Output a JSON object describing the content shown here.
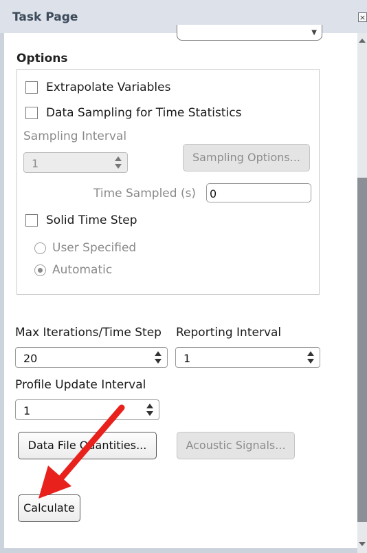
{
  "title": "Task Page",
  "close_icon_glyph": "×",
  "options": {
    "heading": "Options",
    "extrapolate_label": "Extrapolate Variables",
    "data_sampling_label": "Data Sampling for Time Statistics",
    "sampling_interval_label": "Sampling Interval",
    "sampling_interval_value": "1",
    "sampling_options_button": "Sampling Options...",
    "time_sampled_label": "Time Sampled (s)",
    "time_sampled_value": "0",
    "solid_time_step_label": "Solid Time Step",
    "user_specified_label": "User Specified",
    "automatic_label": "Automatic"
  },
  "iterations": {
    "max_iter_label": "Max Iterations/Time Step",
    "max_iter_value": "20",
    "reporting_label": "Reporting Interval",
    "reporting_value": "1",
    "profile_label": "Profile Update Interval",
    "profile_value": "1"
  },
  "buttons": {
    "data_file_quantities": "Data File Quantities...",
    "acoustic_signals": "Acoustic Signals...",
    "calculate": "Calculate"
  },
  "annotation_color": "#e8211d"
}
